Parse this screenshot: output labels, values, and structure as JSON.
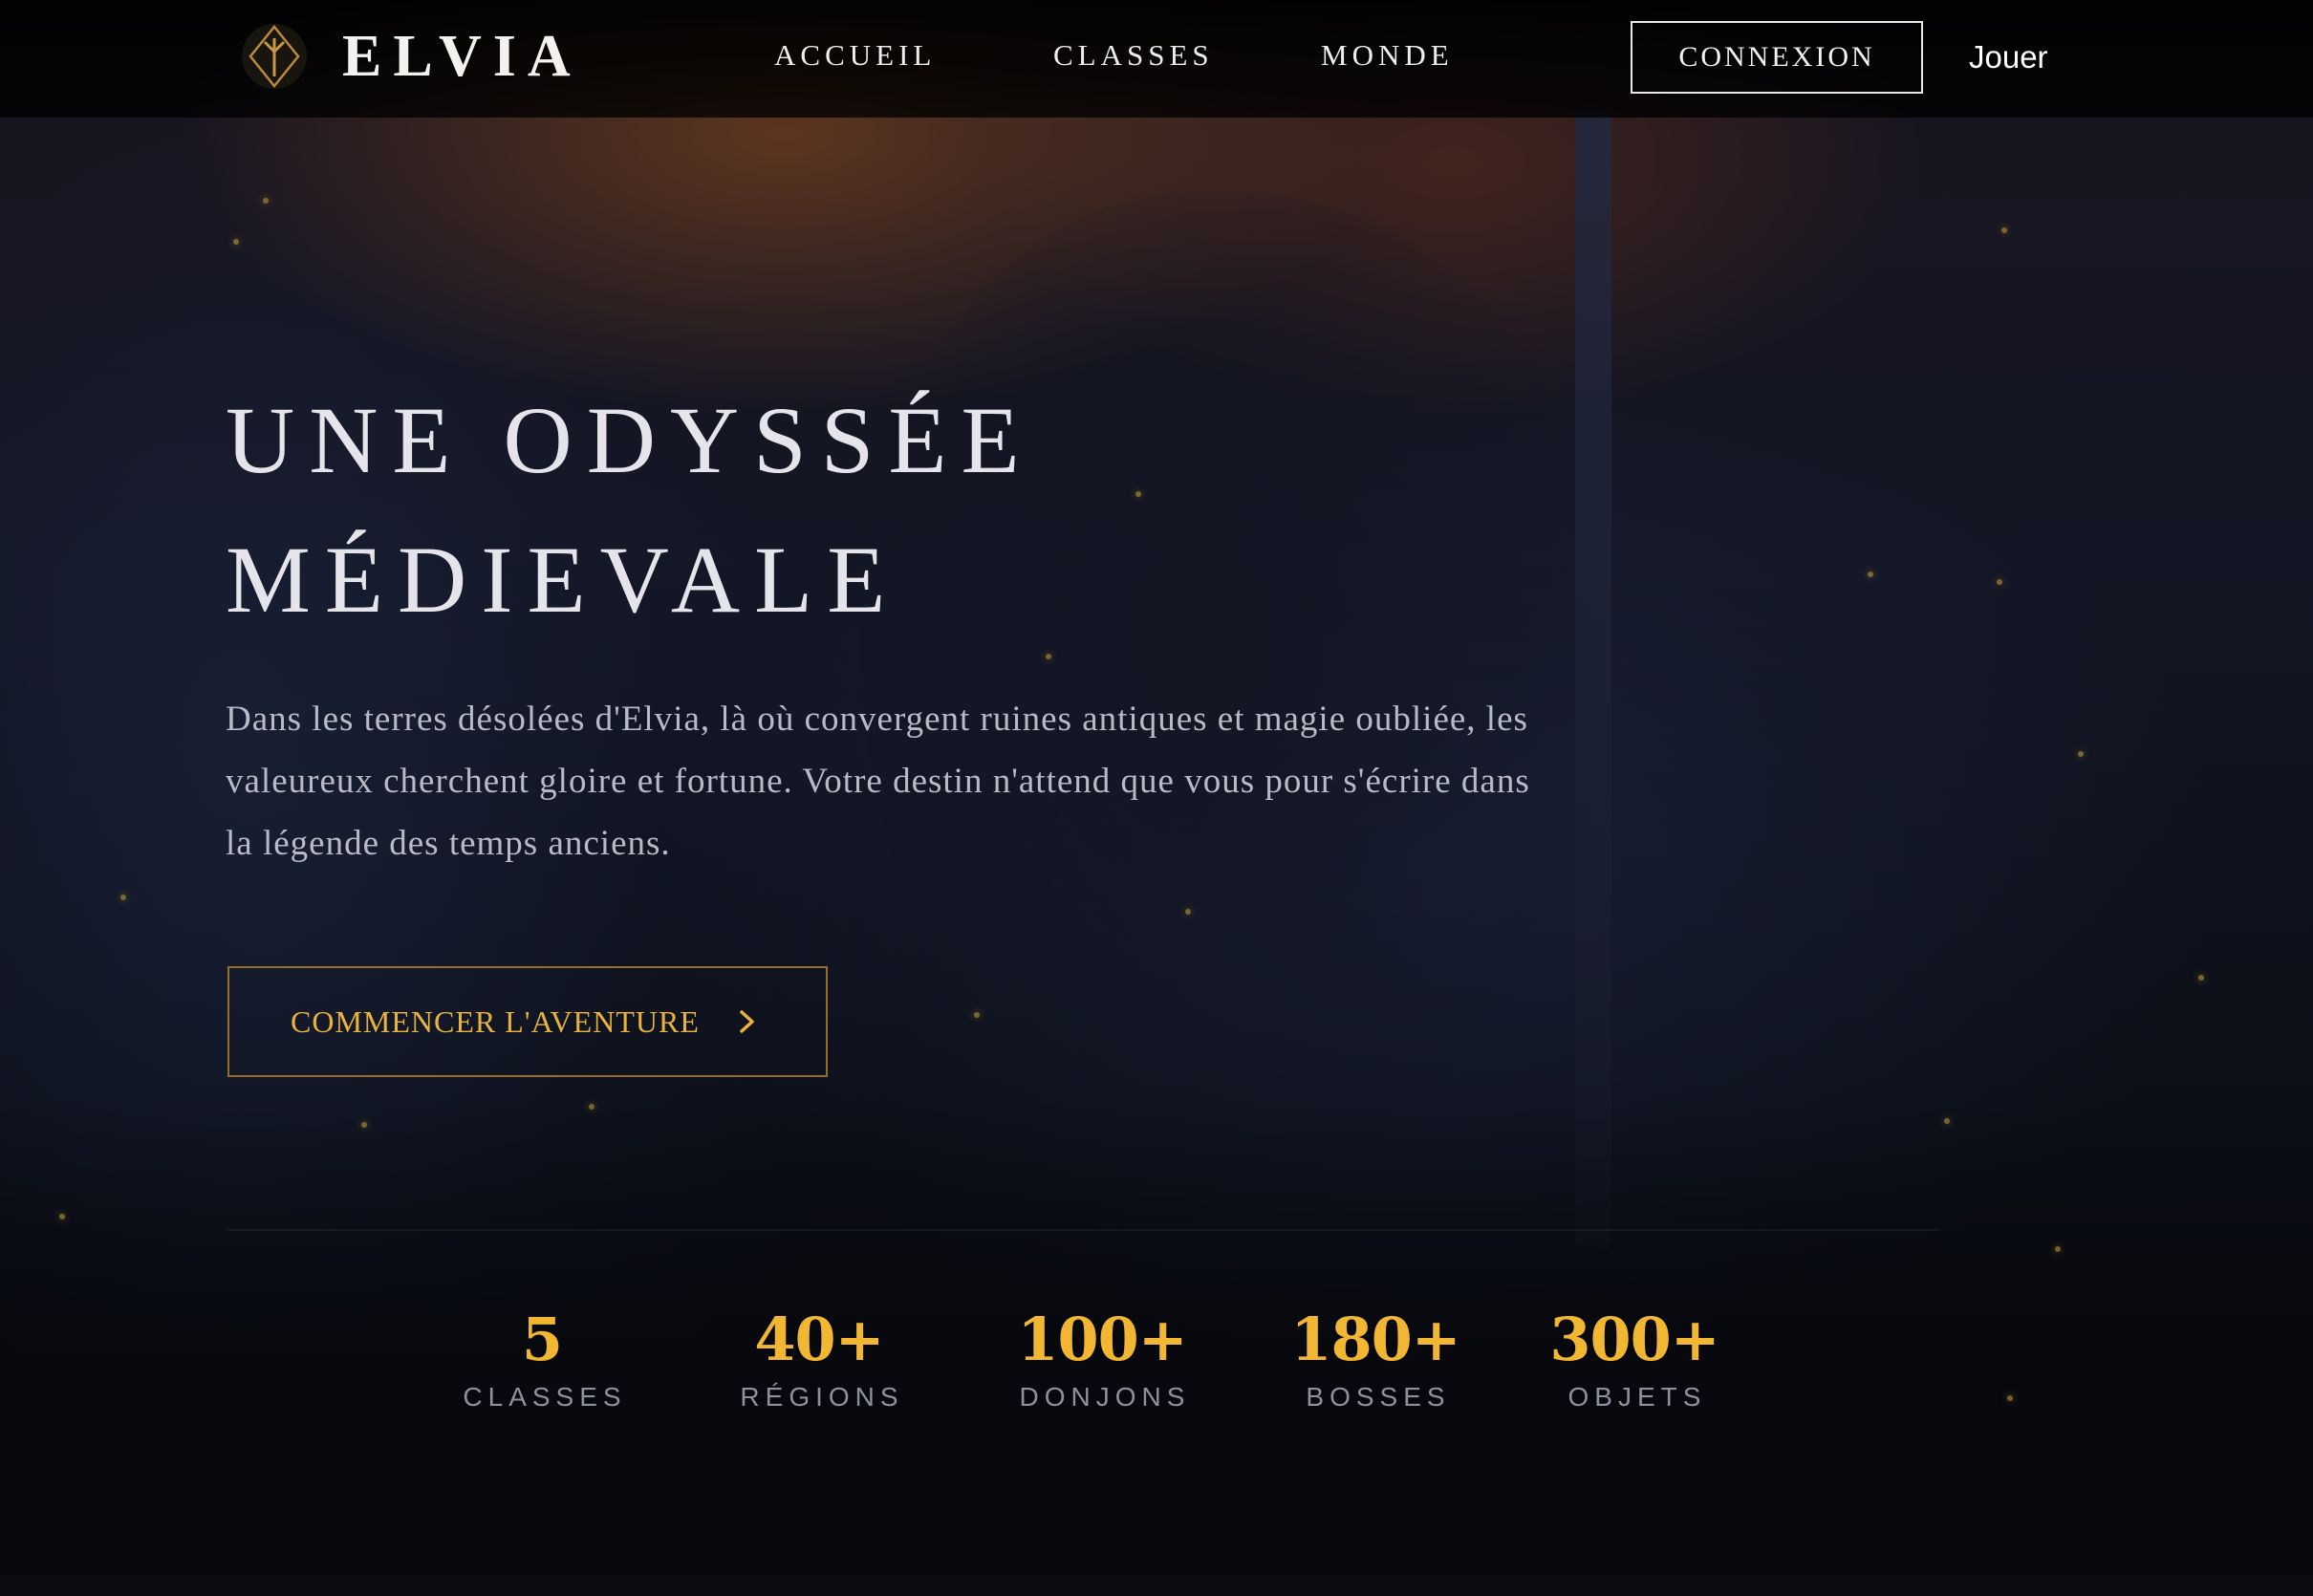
{
  "header": {
    "brand": "ELVIA",
    "logo_icon": "rune-diamond-icon",
    "nav": [
      {
        "label": "ACCUEIL"
      },
      {
        "label": "CLASSES"
      },
      {
        "label": "MONDE"
      }
    ],
    "login_label": "CONNEXION",
    "play_label": "Jouer"
  },
  "hero": {
    "title_line1": "UNE ODYSSÉE",
    "title_line2": "MÉDIEVALE",
    "description": "Dans les terres désolées d'Elvia, là où convergent ruines antiques et magie oubliée, les valeureux cherchent gloire et fortune. Votre destin n'attend que vous pour s'écrire dans la légende des temps anciens.",
    "cta_label": "COMMENCER L'AVENTURE",
    "cta_icon": "chevron-right-icon"
  },
  "stats": [
    {
      "value": "5",
      "label": "CLASSES"
    },
    {
      "value": "40+",
      "label": "RÉGIONS"
    },
    {
      "value": "100+",
      "label": "DONJONS"
    },
    {
      "value": "180+",
      "label": "BOSSES"
    },
    {
      "value": "300+",
      "label": "OBJETS"
    }
  ],
  "colors": {
    "accent_gold": "#f1b733",
    "cta_gold": "#e9b23b",
    "text_light": "#e4e4ea",
    "text_muted": "#b9bac6",
    "background": "#07080d"
  }
}
